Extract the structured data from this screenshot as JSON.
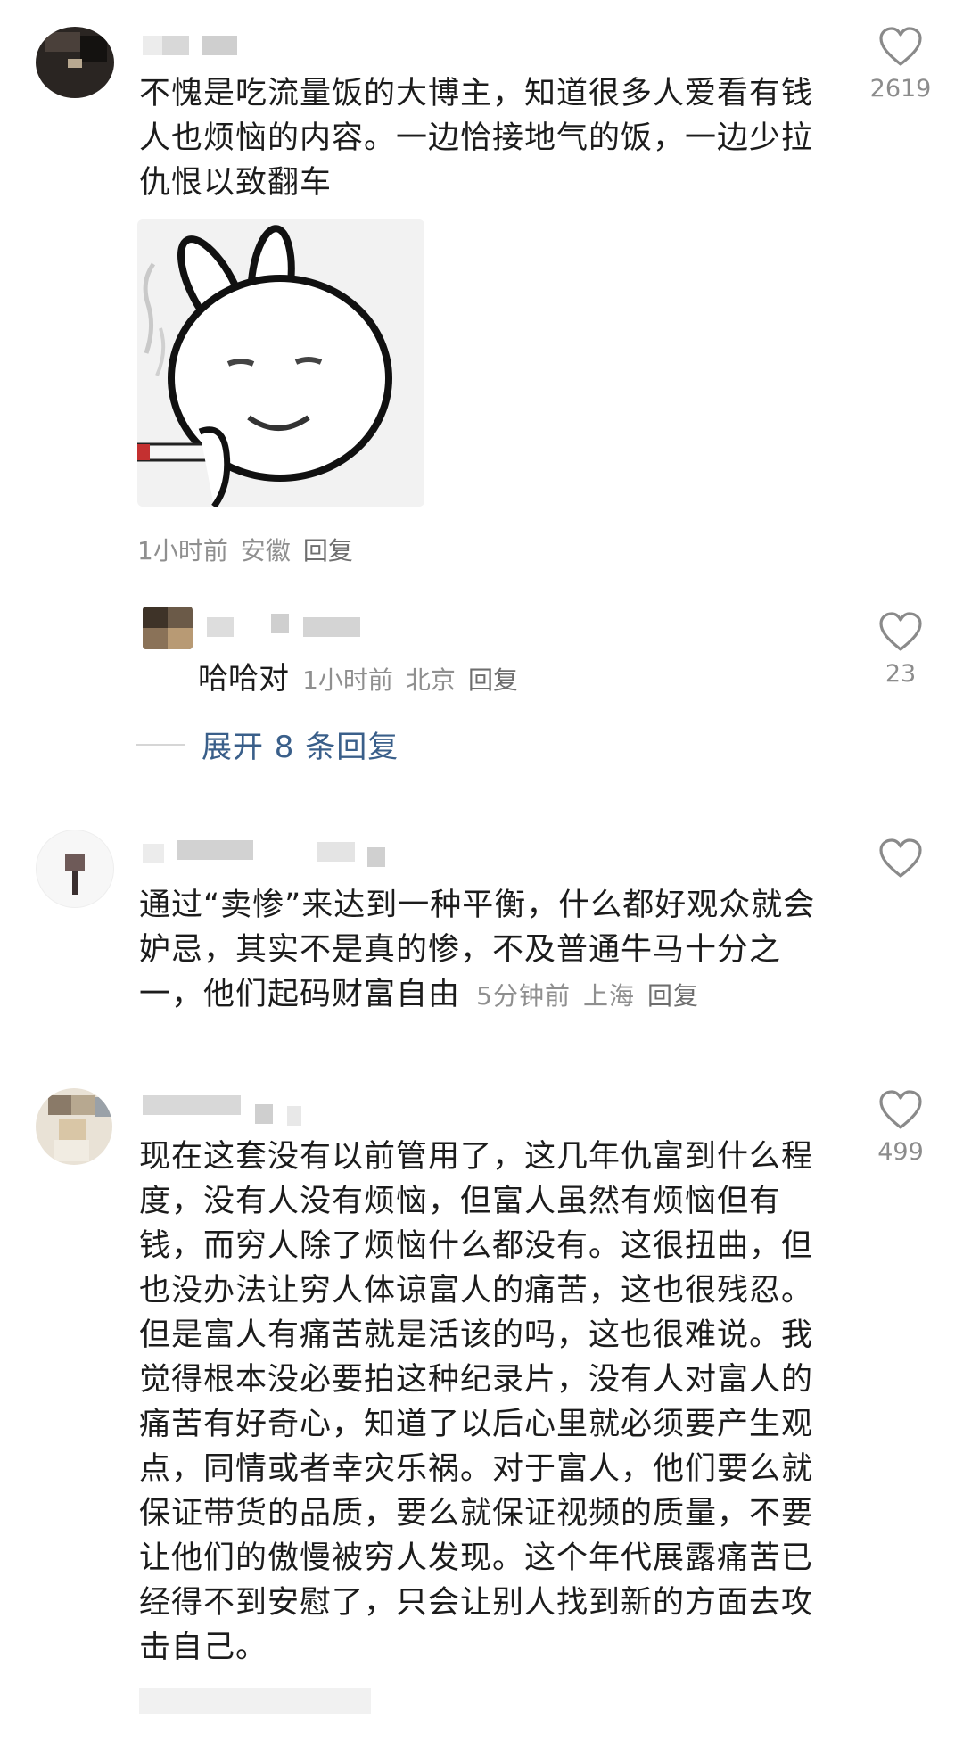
{
  "comments": [
    {
      "text": "不愧是吃流量饭的大博主，知道很多人爱看有钱人也烦恼的内容。一边恰接地气的饭，一边少拉仇恨以致翻车",
      "time": "1小时前",
      "location": "安徽",
      "reply_label": "回复",
      "likes": "2619",
      "sticker_icon": "bunny-smoking-sticker"
    },
    {
      "text": "通过“卖惨”来达到一种平衡，什么都好观众就会妒忌，其实不是真的惨，不及普通牛马十分之一，他们起码财富自由",
      "time": "5分钟前",
      "location": "上海",
      "reply_label": "回复",
      "likes": ""
    },
    {
      "text": "现在这套没有以前管用了，这几年仇富到什么程度，没有人没有烦恼，但富人虽然有烦恼但有钱，而穷人除了烦恼什么都没有。这很扭曲，但也没办法让穷人体谅富人的痛苦，这也很残忍。但是富人有痛苦就是活该的吗，这也很难说。我觉得根本没必要拍这种纪录片，没有人对富人的痛苦有好奇心，知道了以后心里就必须要产生观点，同情或者幸灾乐祸。对于富人，他们要么就保证带货的品质，要么就保证视频的质量，不要让他们的傲慢被穷人发现。这个年代展露痛苦已经得不到安慰了，只会让别人找到新的方面去攻击自己。",
      "likes": "499"
    }
  ],
  "reply": {
    "text": "哈哈对",
    "time": "1小时前",
    "location": "北京",
    "reply_label": "回复",
    "likes": "23"
  },
  "expand_label": "展开 8 条回复",
  "colors": {
    "link": "#3a5f8a",
    "meta": "#8f8f8f",
    "heart": "#8a8a8a"
  }
}
